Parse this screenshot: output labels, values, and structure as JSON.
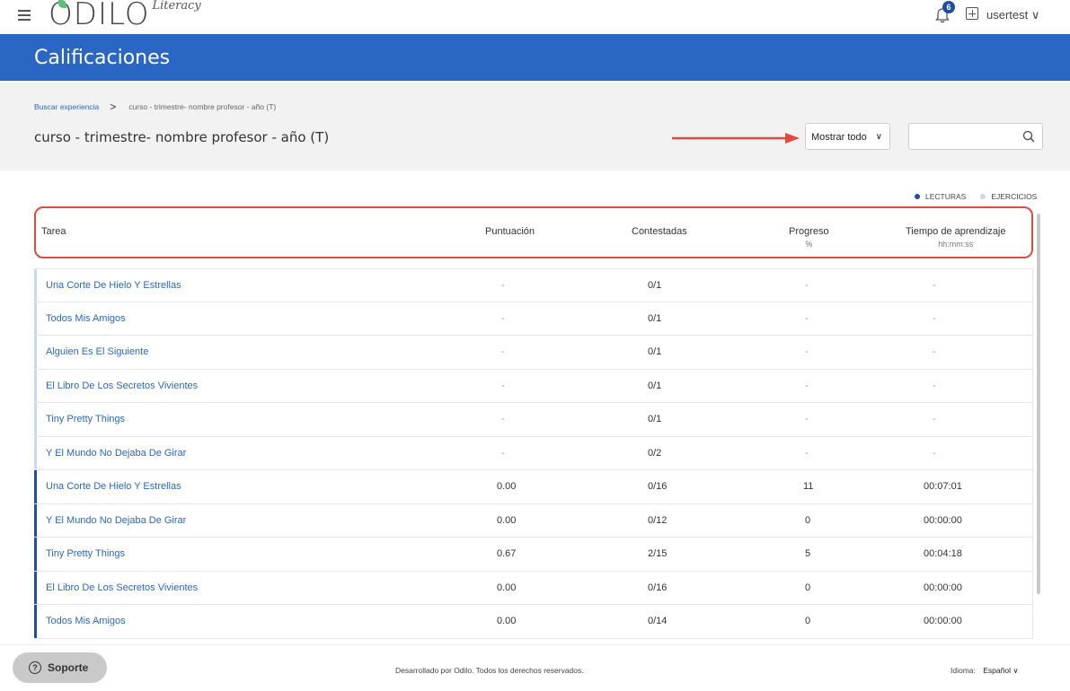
{
  "topbar": {
    "logo_text": "ODILO",
    "logo_sub": "Literacy",
    "notification_count": "6",
    "user_label": "usertest ∨"
  },
  "header": {
    "title": "Calificaciones"
  },
  "breadcrumb": {
    "link": "Buscar experiencia",
    "separator": ">",
    "current": "curso - trimestre- nombre profesor - año (T)"
  },
  "experience_title": "curso - trimestre- nombre profesor - año (T)",
  "filter": {
    "selected": "Mostrar todo",
    "chevron": "∨"
  },
  "search": {
    "value": "",
    "placeholder": ""
  },
  "legend": {
    "items": [
      {
        "label": "LECTURAS",
        "color": "#1d4fa3"
      },
      {
        "label": "EJERCICIOS",
        "color": "#c9d8ee"
      }
    ]
  },
  "table": {
    "columns": [
      {
        "label": "Tarea",
        "sub": ""
      },
      {
        "label": "Puntuación",
        "sub": ""
      },
      {
        "label": "Contestadas",
        "sub": ""
      },
      {
        "label": "Progreso",
        "sub": "%"
      },
      {
        "label": "Tiempo de aprendizaje",
        "sub": "hh:mm:ss"
      }
    ],
    "rows": [
      {
        "task": "Una Corte De Hielo Y Estrellas",
        "score": "-",
        "answered": "0/1",
        "progress": "-",
        "time": "-",
        "type": "ejercicios"
      },
      {
        "task": "Todos Mis Amigos",
        "score": "-",
        "answered": "0/1",
        "progress": "-",
        "time": "-",
        "type": "ejercicios"
      },
      {
        "task": "Alguien Es El Siguiente",
        "score": "-",
        "answered": "0/1",
        "progress": "-",
        "time": "-",
        "type": "ejercicios"
      },
      {
        "task": "El Libro De Los Secretos Vivientes",
        "score": "-",
        "answered": "0/1",
        "progress": "-",
        "time": "-",
        "type": "ejercicios"
      },
      {
        "task": "Tiny Pretty Things",
        "score": "-",
        "answered": "0/1",
        "progress": "-",
        "time": "-",
        "type": "ejercicios"
      },
      {
        "task": "Y El Mundo No Dejaba De Girar",
        "score": "-",
        "answered": "0/2",
        "progress": "-",
        "time": "-",
        "type": "ejercicios"
      },
      {
        "task": "Una Corte De Hielo Y Estrellas",
        "score": "0.00",
        "answered": "0/16",
        "progress": "11",
        "time": "00:07:01",
        "type": "lecturas"
      },
      {
        "task": "Y El Mundo No Dejaba De Girar",
        "score": "0.00",
        "answered": "0/12",
        "progress": "0",
        "time": "00:00:00",
        "type": "lecturas"
      },
      {
        "task": "Tiny Pretty Things",
        "score": "0.67",
        "answered": "2/15",
        "progress": "5",
        "time": "00:04:18",
        "type": "lecturas"
      },
      {
        "task": "El Libro De Los Secretos Vivientes",
        "score": "0.00",
        "answered": "0/16",
        "progress": "0",
        "time": "00:00:00",
        "type": "lecturas"
      },
      {
        "task": "Todos Mis Amigos",
        "score": "0.00",
        "answered": "0/14",
        "progress": "0",
        "time": "00:00:00",
        "type": "lecturas"
      }
    ]
  },
  "footer": {
    "support_label": "Soporte",
    "copyright": "Desarrollado por Odilo. Todos los derechos reservados.",
    "language_label": "Idioma:",
    "language_value": "Español ∨"
  },
  "colors": {
    "brand_blue": "#2a67c4",
    "annotation_red": "#e24a3b",
    "lecturas": "#1d4fa3",
    "ejercicios": "#c9d8ee"
  }
}
